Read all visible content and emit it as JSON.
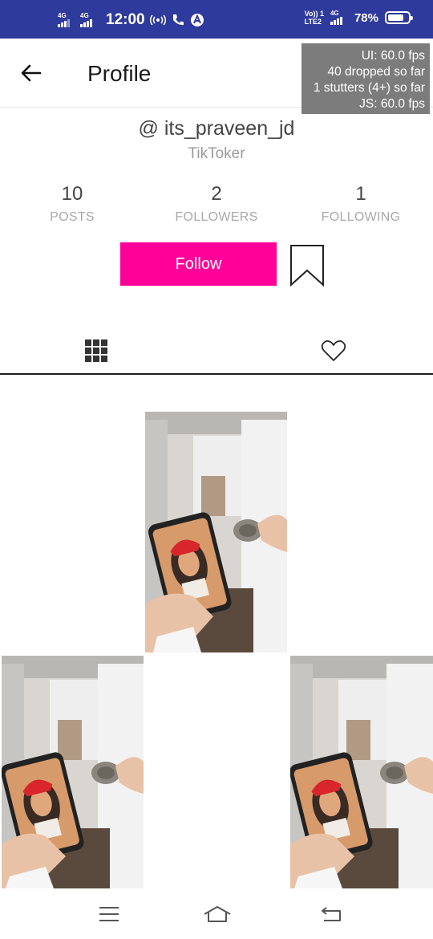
{
  "status_bar": {
    "network1": "4G",
    "network2": "4G",
    "time": "12:00",
    "volte_top": "Vo)) 1",
    "volte_bottom": "LTE2",
    "network3": "4G",
    "battery_percent": "78%",
    "battery_level": 0.78,
    "background_color": "#2e3a9c"
  },
  "header": {
    "title": "Profile",
    "back_icon": "arrow-left-icon"
  },
  "perf_monitor": {
    "ui_fps": "UI: 60.0 fps",
    "dropped": "40 dropped so far",
    "stutters": "1 stutters (4+) so far",
    "js_fps": "JS: 60.0 fps"
  },
  "profile": {
    "username": "@ its_praveen_jd",
    "subtitle": "TikToker",
    "stats": [
      {
        "value": "10",
        "label": "POSTS"
      },
      {
        "value": "2",
        "label": "FOLLOWERS"
      },
      {
        "value": "1",
        "label": "FOLLOWING"
      }
    ],
    "follow_label": "Follow",
    "follow_color": "#ff0099",
    "bookmark_icon": "bookmark-icon"
  },
  "tabs": [
    {
      "icon": "grid-icon"
    },
    {
      "icon": "heart-icon"
    }
  ],
  "videos": [
    {
      "thumbnail": "video-thumbnail"
    },
    {
      "thumbnail": "video-thumbnail"
    },
    {
      "thumbnail": "video-thumbnail"
    }
  ],
  "navbar": {
    "items": [
      "menu-icon",
      "home-icon",
      "back-icon"
    ]
  }
}
